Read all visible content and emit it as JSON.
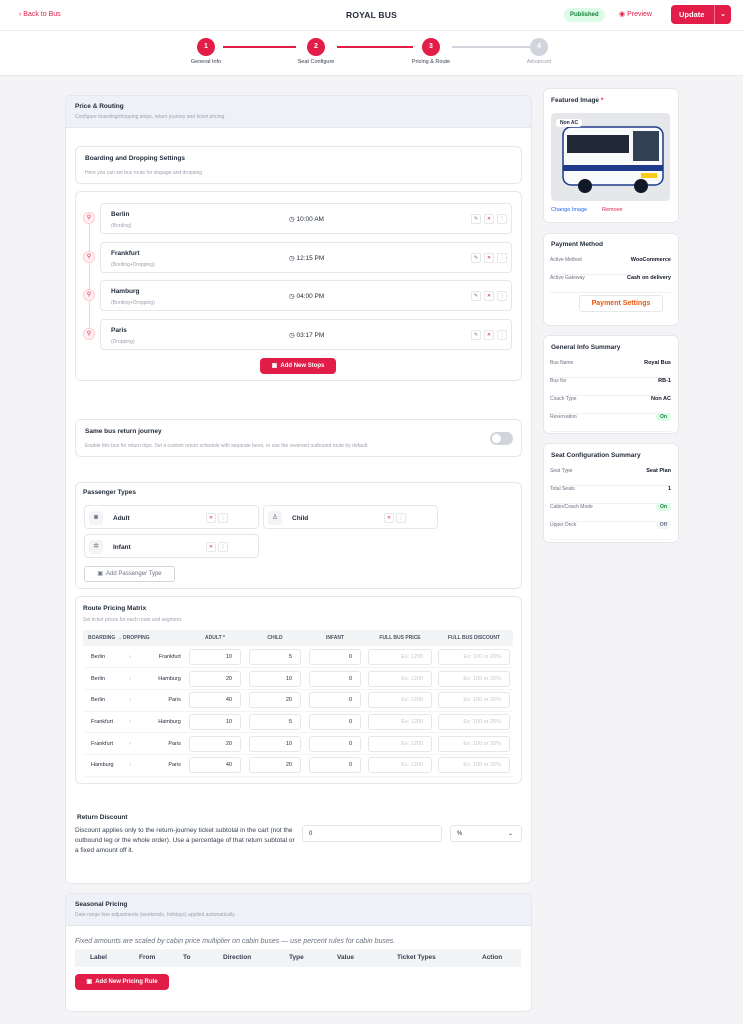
{
  "header": {
    "back": "Back to Bus",
    "title": "ROYAL BUS",
    "status": "Published",
    "preview": "Preview",
    "update": "Update"
  },
  "steps": [
    {
      "num": "1",
      "label": "General Info"
    },
    {
      "num": "2",
      "label": "Seat Configure"
    },
    {
      "num": "3",
      "label": "Pricing & Route"
    },
    {
      "num": "4",
      "label": "Advanced"
    }
  ],
  "pricing": {
    "title": "Price & Routing",
    "subtitle": "Configure boarding/dropping stops, return journey and ticket pricing.",
    "bd_title": "Boarding and Dropping Settings",
    "bd_sub": "Here you can set bus route for stopage and dropping",
    "stops": [
      {
        "name": "Berlin",
        "type": "(Bording)",
        "time": "10:00 AM"
      },
      {
        "name": "Frankfurt",
        "type": "(Bording+Dropping)",
        "time": "12:15 PM"
      },
      {
        "name": "Hamburg",
        "type": "(Bording+Dropping)",
        "time": "04:00 PM"
      },
      {
        "name": "Paris",
        "type": "(Dropping)",
        "time": "03:17 PM"
      }
    ],
    "add_stops": "Add New Stops",
    "return_title": "Same bus return journey",
    "return_sub": "Enable this bus for return trips. Set a custom return schedule with separate fares, or use the reversed outbound route by default.",
    "passenger_title": "Passenger Types",
    "passengers": [
      "Adult",
      "Child",
      "Infant"
    ],
    "add_passenger": "Add Passenger Type",
    "matrix_title": "Route Pricing Matrix",
    "matrix_sub": "Set ticket prices for each route and segment.",
    "headers": [
      "BOARDING → DROPPING",
      "ADULT *",
      "CHILD",
      "INFANT",
      "FULL BUS PRICE",
      "FULL BUS DISCOUNT"
    ],
    "ph_price": "Ex: 1200",
    "ph_discount": "Ex: 100 or 20%",
    "rows": [
      [
        "Berlin",
        "Frankfurt",
        "10",
        "5",
        "0"
      ],
      [
        "Berlin",
        "Hamburg",
        "20",
        "10",
        "0"
      ],
      [
        "Berlin",
        "Paris",
        "40",
        "20",
        "0"
      ],
      [
        "Frankfurt",
        "Hamburg",
        "10",
        "5",
        "0"
      ],
      [
        "Frankfurt",
        "Paris",
        "20",
        "10",
        "0"
      ],
      [
        "Hamburg",
        "Paris",
        "40",
        "20",
        "0"
      ]
    ],
    "rd_title": "Return Discount",
    "rd_text": "Discount applies only to the return-journey ticket subtotal in the cart (not the outbound leg or the whole order). Use a percentage of that return subtotal or a fixed amount off it.",
    "rd_value": "0",
    "rd_unit": "%"
  },
  "seasonal": {
    "title": "Seasonal Pricing",
    "subtitle": "Date-range fare adjustments (weekends, holidays) applied automatically.",
    "note": "Fixed amounts are scaled by cabin price multiplier on cabin buses — use percent rules for cabin buses.",
    "cols": [
      "Label",
      "From",
      "To",
      "Direction",
      "Type",
      "Value",
      "Ticket Types",
      "Action"
    ],
    "add": "Add New Pricing Rule"
  },
  "sidebar": {
    "featured": "Featured Image",
    "img_tag": "Non AC",
    "change": "Change Image",
    "remove": "Remove",
    "pay_title": "Payment Method",
    "active_method": "Active Method",
    "method_val": "WooCommerce",
    "active_gateway": "Active Gateway",
    "gateway_val": "Cash on delivery",
    "pay_btn": "Payment Settings",
    "gi_title": "General Info Summary",
    "gi": [
      [
        "Bus Name",
        "Royal Bus"
      ],
      [
        "Bus No",
        "RB-1"
      ],
      [
        "Coach Type",
        "Non AC"
      ],
      [
        "Reservation",
        "On"
      ]
    ],
    "sc_title": "Seat Configuration Summary",
    "sc": [
      [
        "Seat Type",
        "Seat Plan"
      ],
      [
        "Total Seats",
        "1"
      ],
      [
        "Cabin/Coach Mode",
        "On"
      ],
      [
        "Upper Deck",
        "Off"
      ]
    ]
  }
}
